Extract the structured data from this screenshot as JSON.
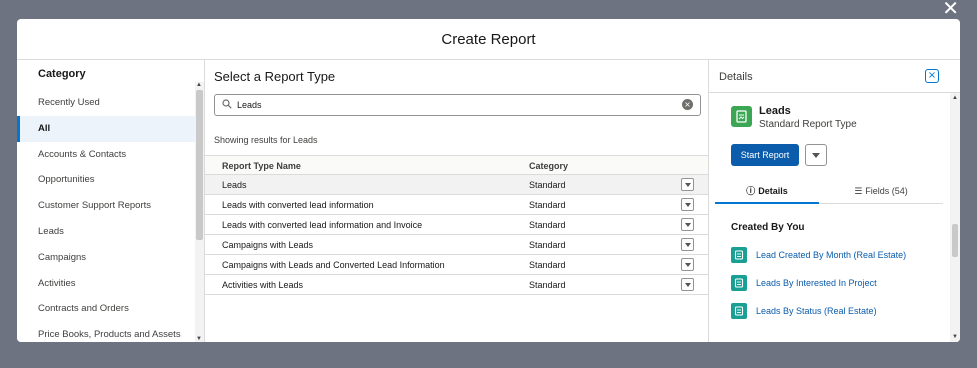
{
  "modal": {
    "title": "Create Report"
  },
  "category": {
    "heading": "Category",
    "items": [
      {
        "label": "Recently Used"
      },
      {
        "label": "All"
      },
      {
        "label": "Accounts & Contacts"
      },
      {
        "label": "Opportunities"
      },
      {
        "label": "Customer Support Reports"
      },
      {
        "label": "Leads"
      },
      {
        "label": "Campaigns"
      },
      {
        "label": "Activities"
      },
      {
        "label": "Contracts and Orders"
      },
      {
        "label": "Price Books, Products and Assets"
      }
    ]
  },
  "report_types": {
    "heading": "Select a Report Type",
    "search_value": "Leads",
    "results_note": "Showing results for Leads",
    "columns": {
      "name": "Report Type Name",
      "category": "Category"
    },
    "rows": [
      {
        "name": "Leads",
        "category": "Standard"
      },
      {
        "name": "Leads with converted lead information",
        "category": "Standard"
      },
      {
        "name": "Leads with converted lead information and Invoice",
        "category": "Standard"
      },
      {
        "name": "Campaigns with Leads",
        "category": "Standard"
      },
      {
        "name": "Campaigns with Leads and Converted Lead Information",
        "category": "Standard"
      },
      {
        "name": "Activities with Leads",
        "category": "Standard"
      }
    ]
  },
  "details": {
    "heading": "Details",
    "title": "Leads",
    "subtitle": "Standard Report Type",
    "start_label": "Start Report",
    "tabs": {
      "details": "Details",
      "fields": "Fields (54)"
    },
    "created_heading": "Created By You",
    "links": [
      {
        "label": "Lead Created By Month (Real Estate)"
      },
      {
        "label": "Leads By Interested In Project"
      },
      {
        "label": "Leads By Status (Real Estate)"
      }
    ]
  },
  "colors": {
    "accent": "#0176d3",
    "brand_button": "#0b5cab",
    "report_type_icon": "#3ba755",
    "report_icon": "#19a094"
  }
}
